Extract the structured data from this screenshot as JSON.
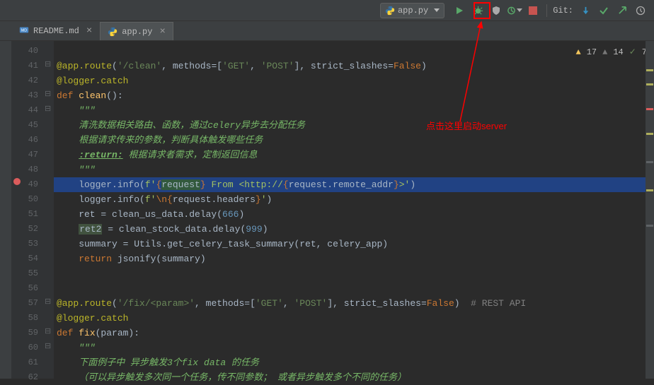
{
  "toolbar": {
    "run_config": "app.py",
    "git_label": "Git:"
  },
  "tabs": [
    {
      "icon": "markdown",
      "label": "README.md",
      "active": false
    },
    {
      "icon": "python",
      "label": "app.py",
      "active": true
    }
  ],
  "inspect": {
    "warn1": "17",
    "warn2": "14",
    "ok": "7"
  },
  "gutter": {
    "start": 40,
    "end": 62
  },
  "breakpoint_line": 49,
  "code": {
    "l40": "",
    "l41_a": "@app.route",
    "l41_b": "(",
    "l41_c": "'/clean'",
    "l41_d": ", ",
    "l41_e": "methods",
    "l41_f": "=[",
    "l41_g": "'GET'",
    "l41_h": ", ",
    "l41_i": "'POST'",
    "l41_j": "], ",
    "l41_k": "strict_slashes",
    "l41_l": "=",
    "l41_m": "False",
    "l41_n": ")",
    "l42": "@logger.catch",
    "l43_a": "def ",
    "l43_b": "clean",
    "l43_c": "():",
    "l44": "    \"\"\"",
    "l45": "    清洗数据相关路由、函数，通过celery异步去分配任务",
    "l46": "    根据请求传来的参数，判断具体触发哪些任务",
    "l47_a": "    ",
    "l47_b": ":return:",
    "l47_c": " 根据请求者需求，定制返回信息",
    "l48": "    \"\"\"",
    "l49_a": "    logger.info(",
    "l49_b": "f'",
    "l49_c": "{",
    "l49_d": "request",
    "l49_e": "}",
    "l49_f": " From <http://",
    "l49_g": "{",
    "l49_h": "request.remote_addr",
    "l49_i": "}",
    "l49_j": ">'",
    "l49_k": ")",
    "l50_a": "    logger.info(",
    "l50_b": "f'",
    "l50_c": "\\n",
    "l50_d": "{",
    "l50_e": "request.headers",
    "l50_f": "}",
    "l50_g": "'",
    "l50_h": ")",
    "l51_a": "    ret = clean_us_data.delay(",
    "l51_b": "666",
    "l51_c": ")",
    "l52_a": "    ",
    "l52_b": "ret2",
    "l52_c": " = clean_stock_data.delay(",
    "l52_d": "999",
    "l52_e": ")",
    "l53_a": "    summary = Utils.get_celery_task_summary(ret",
    "l53_b": ", ",
    "l53_c": "celery_app)",
    "l54_a": "    ",
    "l54_b": "return ",
    "l54_c": "jsonify(summary)",
    "l55": "",
    "l56": "",
    "l57_a": "@app.route",
    "l57_b": "(",
    "l57_c": "'/fix/<param>'",
    "l57_d": ", ",
    "l57_e": "methods",
    "l57_f": "=[",
    "l57_g": "'GET'",
    "l57_h": ", ",
    "l57_i": "'POST'",
    "l57_j": "], ",
    "l57_k": "strict_slashes",
    "l57_l": "=",
    "l57_m": "False",
    "l57_n": ")  ",
    "l57_o": "# REST API",
    "l58": "@logger.catch",
    "l59_a": "def ",
    "l59_b": "fix",
    "l59_c": "(param):",
    "l60": "    \"\"\"",
    "l61": "    下面例子中 异步触发3个fix data 的任务",
    "l62": "    （可以异步触发多次同一个任务，传不同参数； 或者异步触发多个不同的任务）"
  },
  "annotation": "点击这里启动server"
}
